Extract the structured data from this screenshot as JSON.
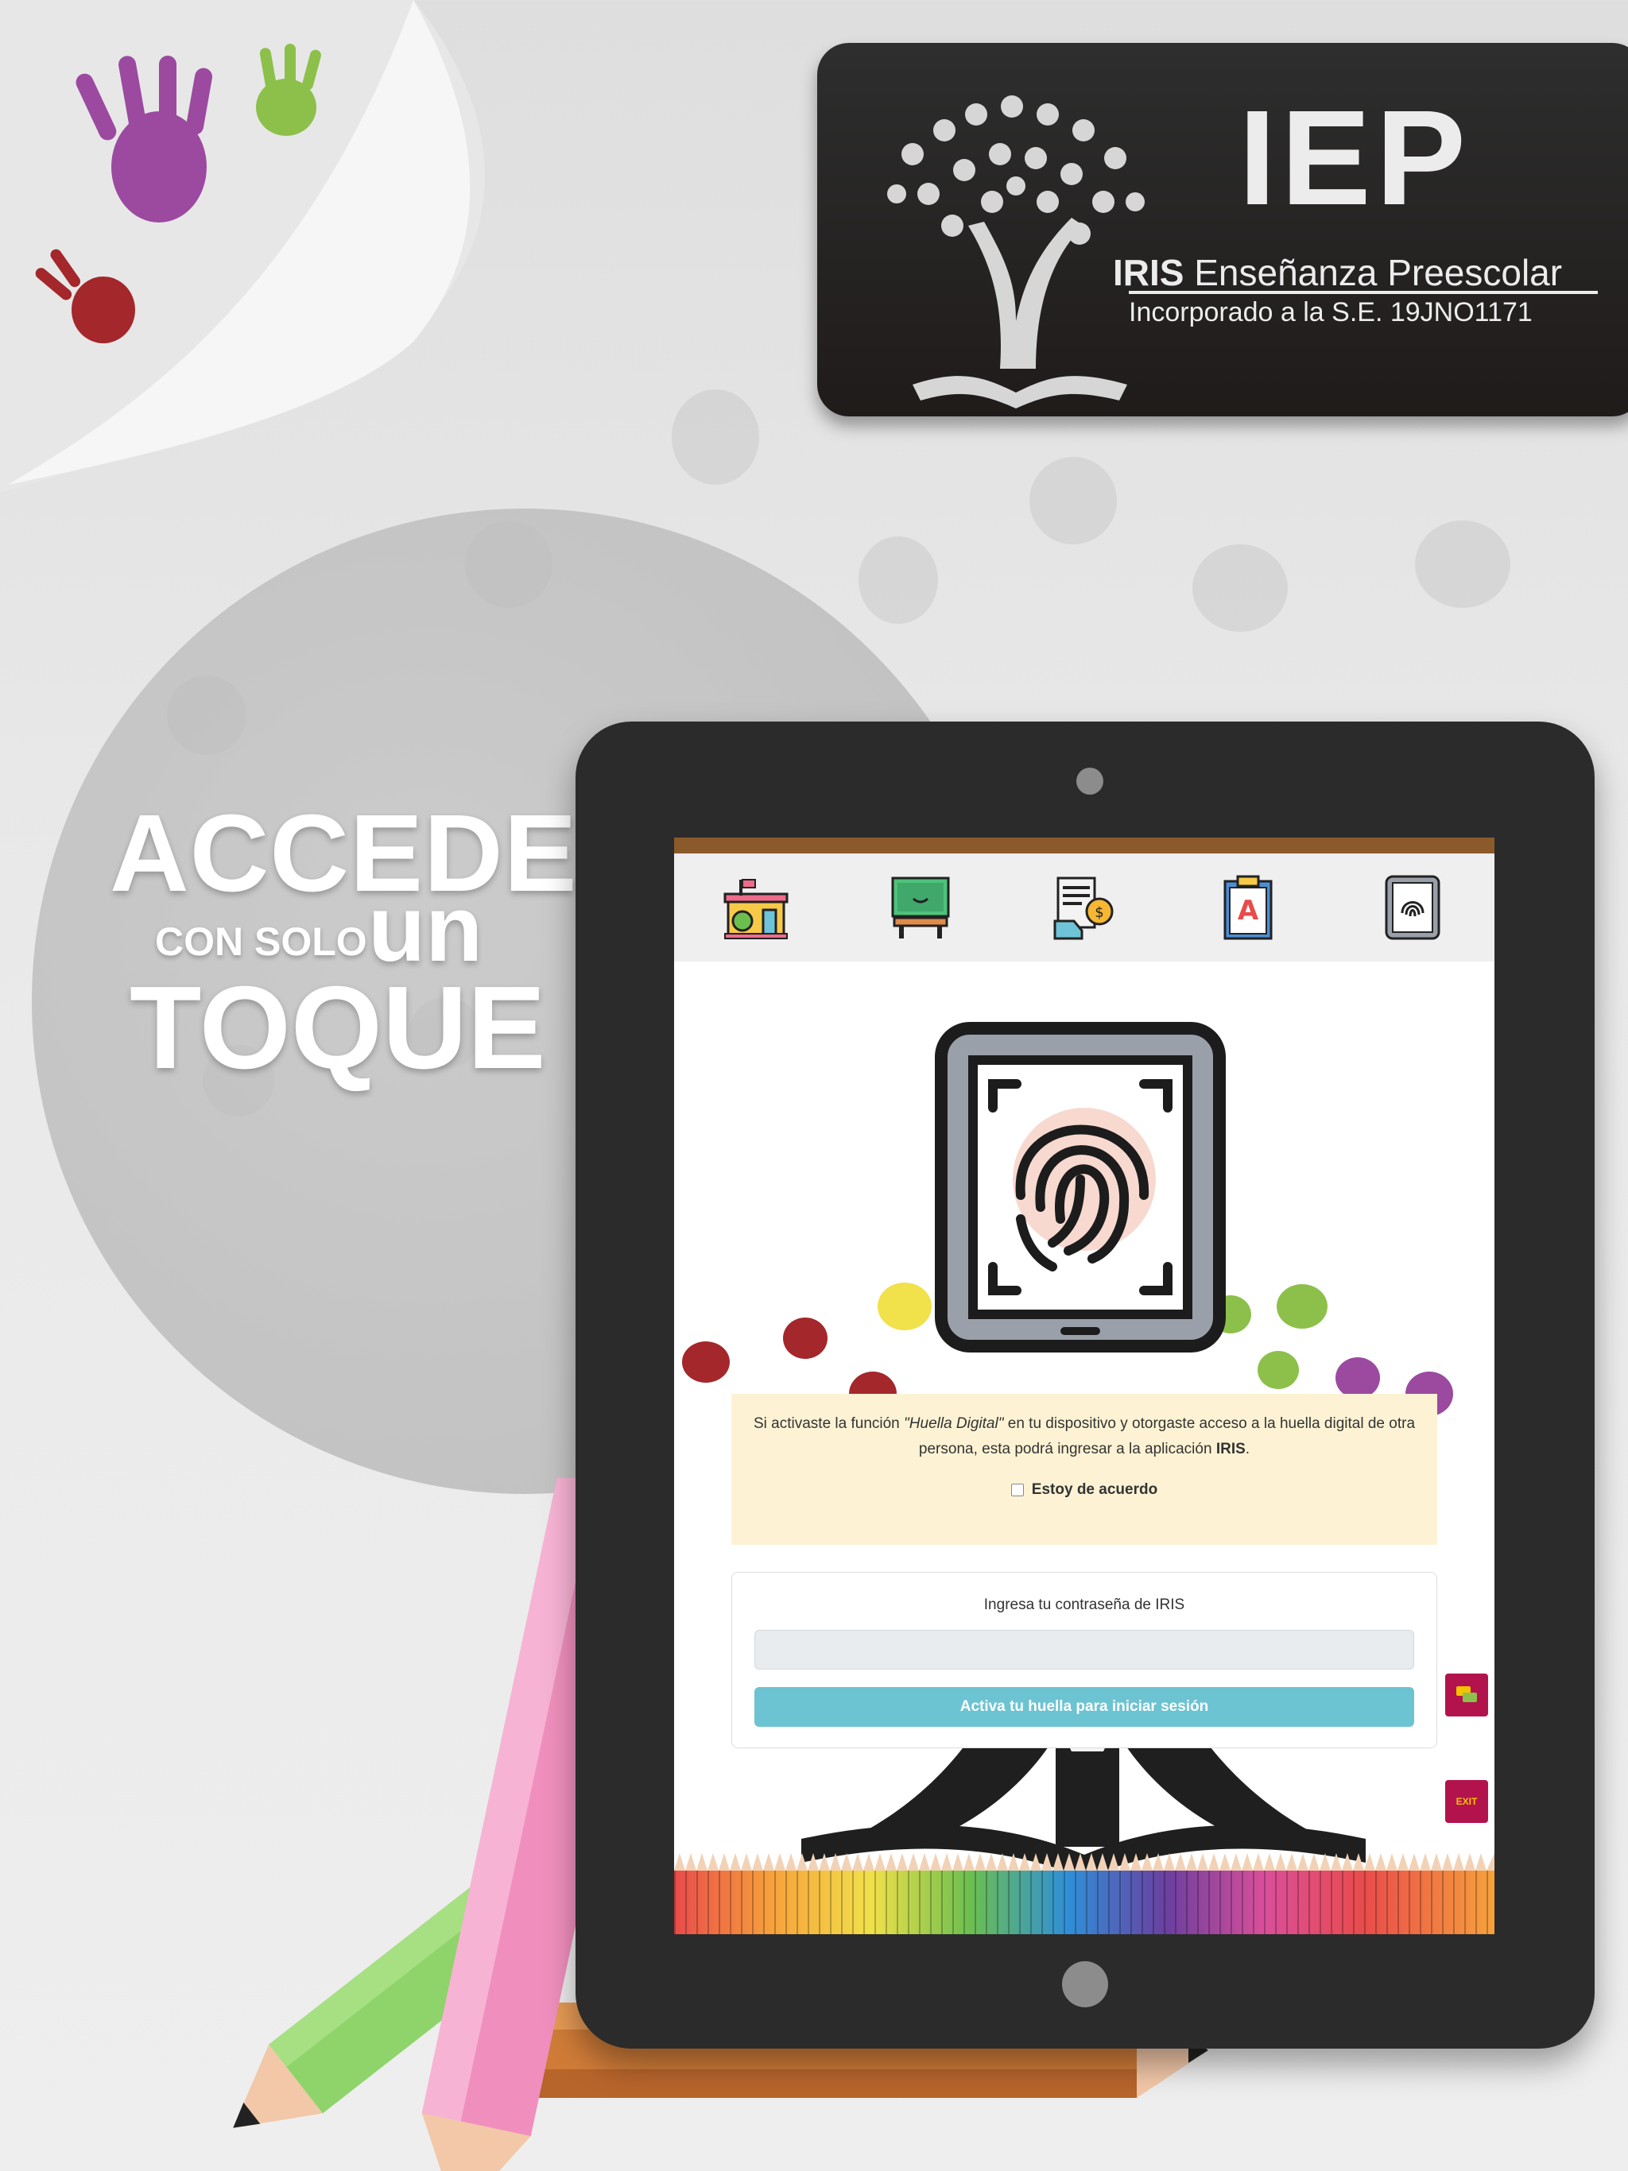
{
  "brand": {
    "acronym": "IEP",
    "name_bold": "IRIS",
    "name_rest": " Enseñanza Preescolar",
    "incorporation": "Incorporado a la S.E. 19JNO1171"
  },
  "headline": {
    "line1": "ACCEDE",
    "line2_small": "CON SOLO",
    "line2_big": "un",
    "line3": "TOQUE"
  },
  "app": {
    "nav": [
      {
        "name": "school-icon"
      },
      {
        "name": "classroom-board-icon"
      },
      {
        "name": "payment-receipt-icon"
      },
      {
        "name": "grades-clipboard-icon"
      },
      {
        "name": "fingerprint-icon"
      }
    ],
    "notice": {
      "part1": "Si activaste la función ",
      "feature": "\"Huella Digital\"",
      "part2": " en tu dispositivo y otorgaste acceso a la huella digital de otra persona, esta podrá ingresar a la aplicación ",
      "app_name": "IRIS",
      "part3": ".",
      "agree_label": "Estoy de acuerdo"
    },
    "login": {
      "label": "Ingresa tu contraseña de IRIS",
      "input_value": "",
      "button_label": "Activa tu huella para iniciar sesión"
    },
    "side_buttons": {
      "chat_icon": "chat-icon",
      "exit_label": "EXIT"
    }
  },
  "colors": {
    "nav_topbar": "#8a5a2b",
    "notice_bg": "#fdf3d4",
    "login_button": "#6cc3d2",
    "side_button": "#b3134c",
    "hand_purple": "#9b4aa0",
    "hand_green": "#8cc04a",
    "hand_red": "#a3272b"
  }
}
